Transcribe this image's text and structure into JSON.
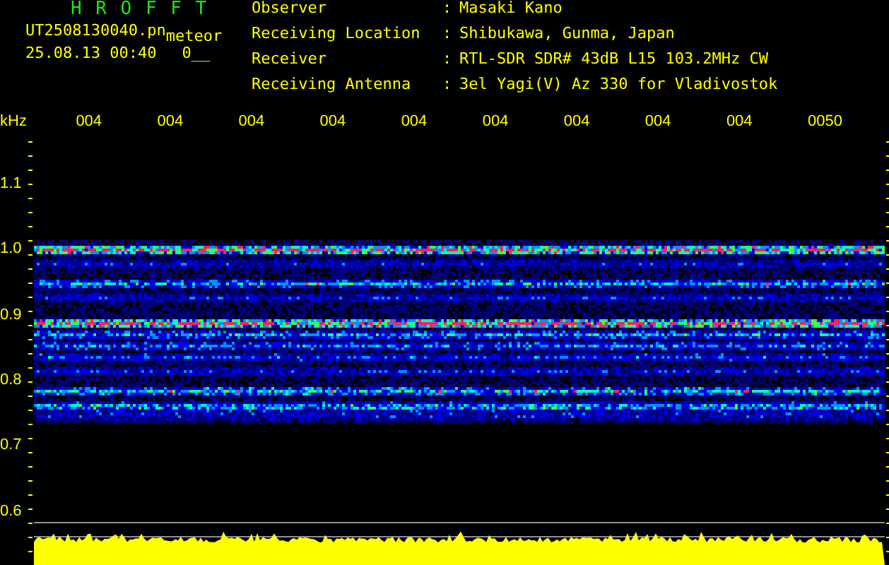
{
  "title": "H R O F F T",
  "file_name": "UT2508130040.pn",
  "event_type": "meteor",
  "timestamp": "25.08.13 00:40",
  "count": "0__",
  "info": [
    {
      "label": "Observer",
      "separator": ":",
      "value": "Masaki Kano"
    },
    {
      "label": "Receiving Location",
      "separator": ":",
      "value": "Shibukawa, Gunma, Japan"
    },
    {
      "label": "Receiver",
      "separator": ":",
      "value": "RTL-SDR SDR# 43dB L15 103.2MHz CW"
    },
    {
      "label": "Receiving Antenna",
      "separator": ":",
      "value": "3el Yagi(V) Az 330 for Vladivostok"
    }
  ],
  "x_axis": {
    "unit": "kHz",
    "labels": [
      "004",
      "004",
      "004",
      "004",
      "004",
      "004",
      "004",
      "004",
      "004",
      "0050"
    ]
  },
  "y_axis": {
    "labels": [
      "1.1",
      "1.0",
      "0.9",
      "0.8",
      "0.7",
      "0.6"
    ]
  }
}
